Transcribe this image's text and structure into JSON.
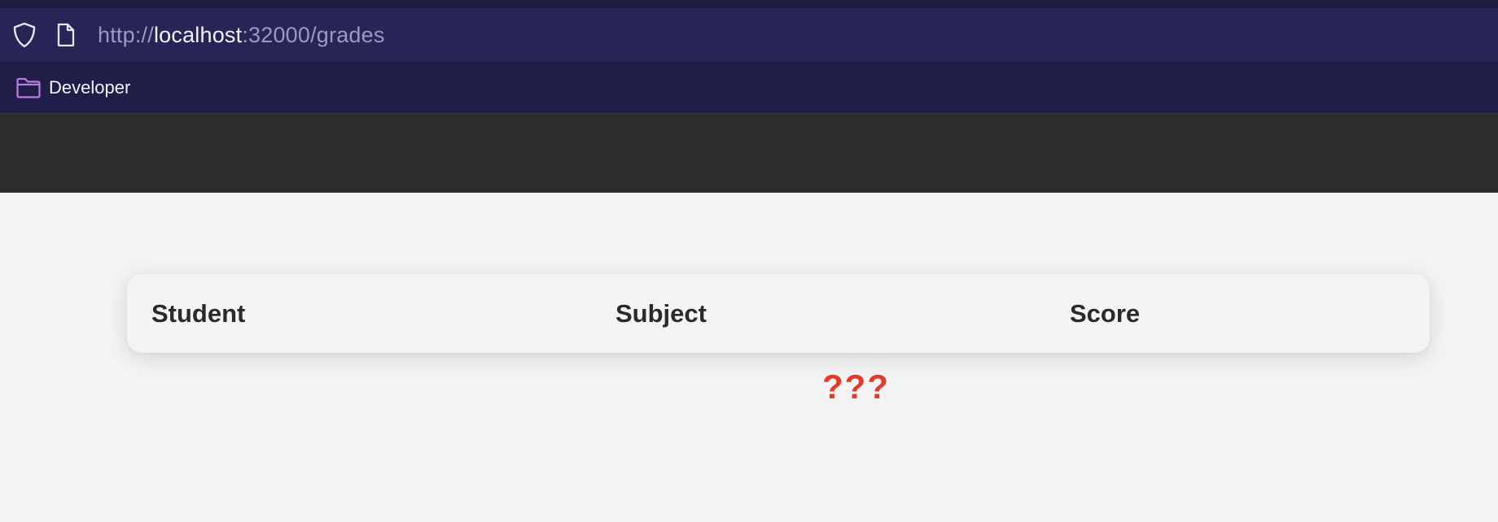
{
  "browser": {
    "url": {
      "scheme": "http://",
      "host": "localhost",
      "rest": ":32000/grades"
    },
    "bookmarks": [
      {
        "label": "Developer",
        "icon": "folder-icon"
      }
    ]
  },
  "table": {
    "headers": [
      "Student",
      "Subject",
      "Score"
    ]
  },
  "placeholder_text": "???",
  "colors": {
    "accent_placeholder": "#e5392a",
    "folder_icon": "#b77ee0",
    "header_bar": "#2d2d2d"
  }
}
